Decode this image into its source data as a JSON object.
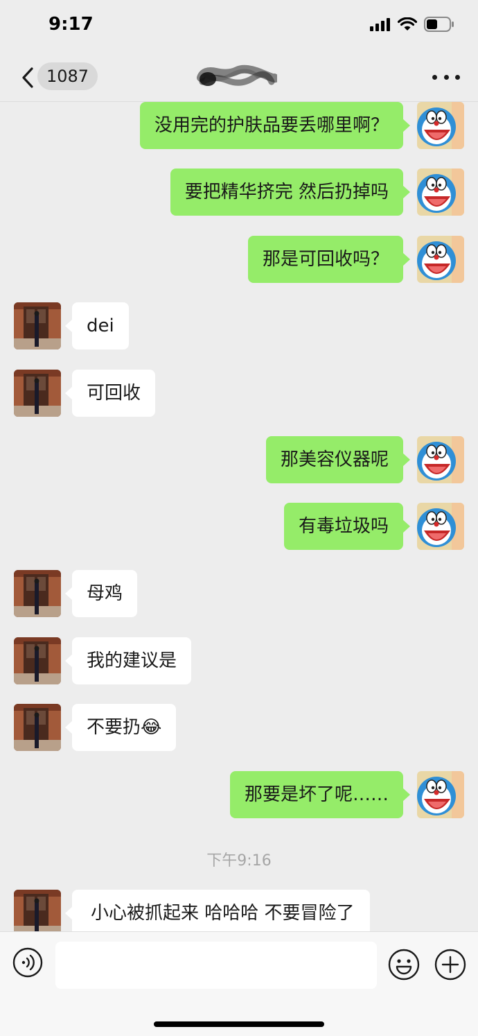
{
  "status_bar": {
    "time": "9:17"
  },
  "nav": {
    "unread_count": "1087"
  },
  "messages": [
    {
      "side": "out",
      "text": "没用完的护肤品要丢哪里啊？"
    },
    {
      "side": "out",
      "text": "要把精华挤完 然后扔掉吗"
    },
    {
      "side": "out",
      "text": "那是可回收吗？"
    },
    {
      "side": "in",
      "text": "dei"
    },
    {
      "side": "in",
      "text": "可回收"
    },
    {
      "side": "out",
      "text": "那美容仪器呢"
    },
    {
      "side": "out",
      "text": "有毒垃圾吗"
    },
    {
      "side": "in",
      "text": "母鸡"
    },
    {
      "side": "in",
      "text": "我的建议是"
    },
    {
      "side": "in",
      "text": "不要扔😂"
    },
    {
      "side": "out",
      "text": "那要是坏了呢……"
    },
    {
      "side": "in",
      "text": "小心被抓起来 哈哈哈 不要冒险了"
    }
  ],
  "timestamp": "下午9:16",
  "input": {
    "value": "",
    "placeholder": ""
  },
  "colors": {
    "background": "#ededed",
    "outgoing_bubble": "#95ec69",
    "incoming_bubble": "#ffffff"
  },
  "icons": {
    "back": "chevron-left-icon",
    "more": "more-dots-icon",
    "voice": "voice-icon",
    "emoji": "emoji-icon",
    "plus": "plus-icon"
  }
}
